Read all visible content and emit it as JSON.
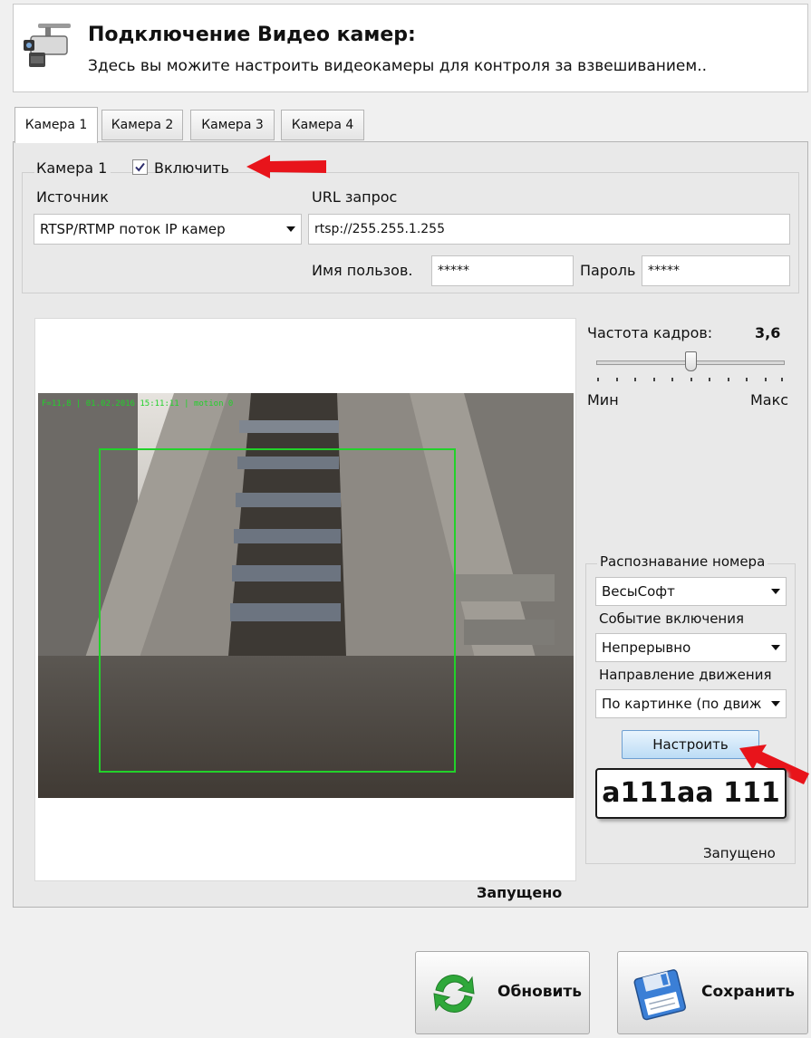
{
  "header": {
    "title": "Подключение Видео камер:",
    "subtitle": "Здесь вы можите настроить видеокамеры для контроля за взвешиванием.."
  },
  "tabs": [
    {
      "label": "Камера 1",
      "active": true
    },
    {
      "label": "Камера 2",
      "active": false
    },
    {
      "label": "Камера 3",
      "active": false
    },
    {
      "label": "Камера 4",
      "active": false
    }
  ],
  "camera": {
    "group_label": "Камера 1",
    "enable_label": "Включить",
    "enabled": true,
    "source_label": "Источник",
    "source_value": "RTSP/RTMP поток IP камер",
    "url_label": "URL запрос",
    "url_value": "rtsp://255.255.1.255",
    "user_label": "Имя пользов.",
    "user_value": "*****",
    "password_label": "Пароль",
    "password_value": "*****"
  },
  "video": {
    "status": "Запущено"
  },
  "frame_rate": {
    "label": "Частота кадров:",
    "value": "3,6",
    "min_label": "Мин",
    "max_label": "Макс",
    "slider_position": 0.5
  },
  "lpr": {
    "title": "Распознавание номера",
    "engine_value": "ВесыСофт",
    "event_label": "Событие включения",
    "event_value": "Непрерывно",
    "direction_label": "Направление движения",
    "direction_value": "По картинке (по движ",
    "setup_button": "Настроить",
    "plate": "a111aa 111",
    "status": "Запущено"
  },
  "footer": {
    "refresh_button": "Обновить",
    "save_button": "Сохранить"
  },
  "colors": {
    "accent_red": "#e8141b",
    "roi_green": "#22d12a",
    "refresh_green": "#2fa83a",
    "save_blue": "#3b7fd6"
  }
}
